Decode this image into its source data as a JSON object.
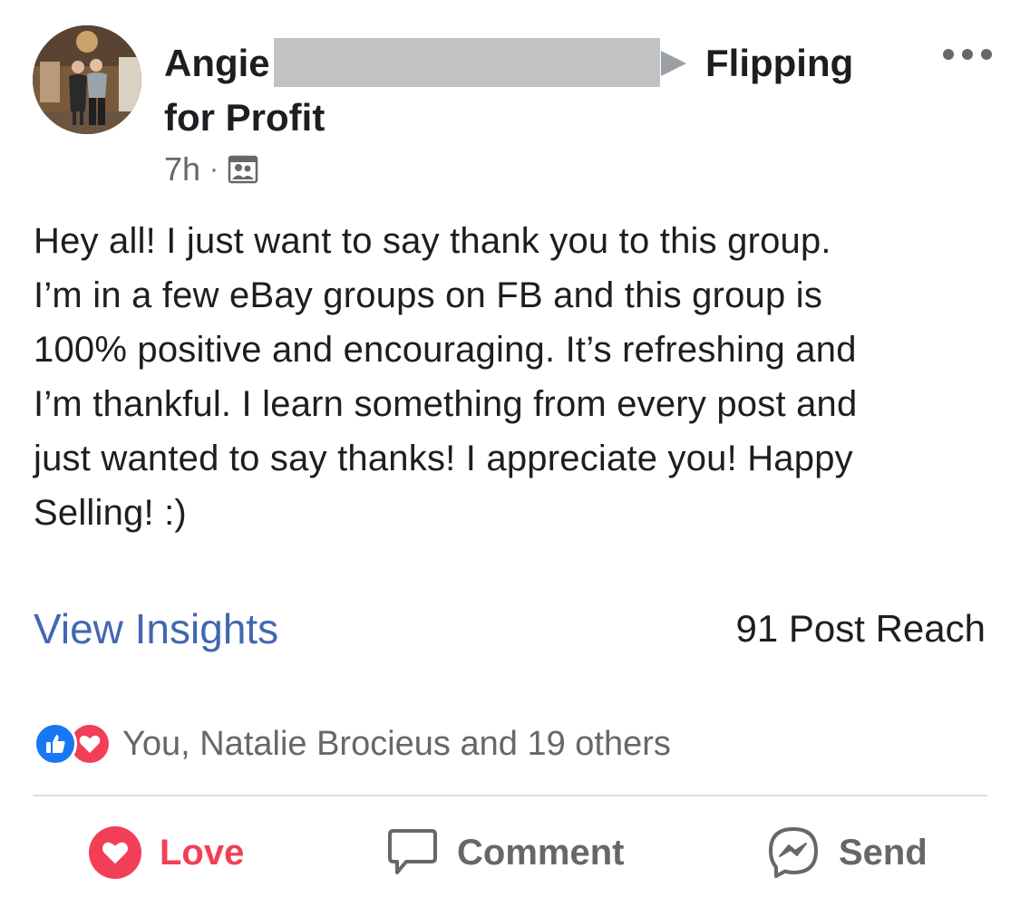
{
  "post": {
    "author": {
      "first_name": "Angie",
      "avatar_icon": "profile-photo-two-people"
    },
    "group": {
      "name_part1": "Flipping",
      "name_part2": "for Profit"
    },
    "timestamp": "7h",
    "separator": "·",
    "audience_icon": "group-members-icon",
    "more_icon": "more-options-icon",
    "body_lines": [
      "Hey all! I just want to say thank you to this group.",
      "I’m in a few eBay groups on FB and this group is",
      "100% positive and encouraging. It’s refreshing and",
      "I’m thankful. I learn something from every post and",
      "just wanted to say thanks! I appreciate you! Happy",
      "Selling! :)"
    ],
    "insights_link": "View Insights",
    "post_reach": "91 Post Reach",
    "reactions_summary": "You, Natalie Brocieus and 19 others",
    "actions": {
      "love": "Love",
      "comment": "Comment",
      "send": "Send"
    },
    "colors": {
      "link_blue": "#4267b2",
      "love_red": "#f33e58",
      "like_blue": "#1877f2",
      "secondary_gray": "#65676b"
    }
  }
}
